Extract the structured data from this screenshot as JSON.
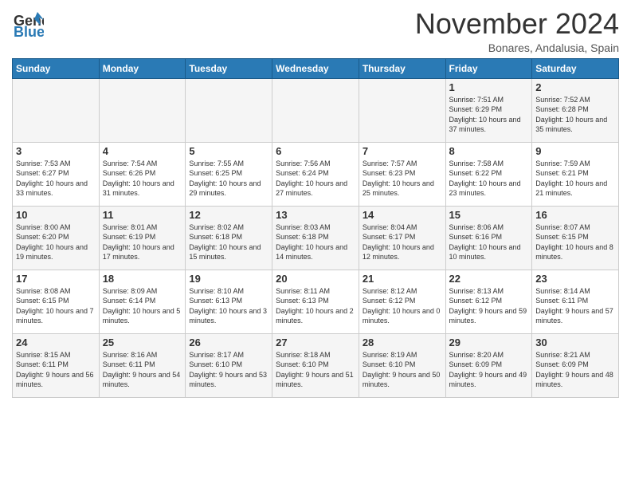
{
  "header": {
    "logo_line1": "General",
    "logo_line2": "Blue",
    "month": "November 2024",
    "location": "Bonares, Andalusia, Spain"
  },
  "weekdays": [
    "Sunday",
    "Monday",
    "Tuesday",
    "Wednesday",
    "Thursday",
    "Friday",
    "Saturday"
  ],
  "weeks": [
    [
      {
        "day": "",
        "sunrise": "",
        "sunset": "",
        "daylight": ""
      },
      {
        "day": "",
        "sunrise": "",
        "sunset": "",
        "daylight": ""
      },
      {
        "day": "",
        "sunrise": "",
        "sunset": "",
        "daylight": ""
      },
      {
        "day": "",
        "sunrise": "",
        "sunset": "",
        "daylight": ""
      },
      {
        "day": "",
        "sunrise": "",
        "sunset": "",
        "daylight": ""
      },
      {
        "day": "1",
        "sunrise": "Sunrise: 7:51 AM",
        "sunset": "Sunset: 6:29 PM",
        "daylight": "Daylight: 10 hours and 37 minutes."
      },
      {
        "day": "2",
        "sunrise": "Sunrise: 7:52 AM",
        "sunset": "Sunset: 6:28 PM",
        "daylight": "Daylight: 10 hours and 35 minutes."
      }
    ],
    [
      {
        "day": "3",
        "sunrise": "Sunrise: 7:53 AM",
        "sunset": "Sunset: 6:27 PM",
        "daylight": "Daylight: 10 hours and 33 minutes."
      },
      {
        "day": "4",
        "sunrise": "Sunrise: 7:54 AM",
        "sunset": "Sunset: 6:26 PM",
        "daylight": "Daylight: 10 hours and 31 minutes."
      },
      {
        "day": "5",
        "sunrise": "Sunrise: 7:55 AM",
        "sunset": "Sunset: 6:25 PM",
        "daylight": "Daylight: 10 hours and 29 minutes."
      },
      {
        "day": "6",
        "sunrise": "Sunrise: 7:56 AM",
        "sunset": "Sunset: 6:24 PM",
        "daylight": "Daylight: 10 hours and 27 minutes."
      },
      {
        "day": "7",
        "sunrise": "Sunrise: 7:57 AM",
        "sunset": "Sunset: 6:23 PM",
        "daylight": "Daylight: 10 hours and 25 minutes."
      },
      {
        "day": "8",
        "sunrise": "Sunrise: 7:58 AM",
        "sunset": "Sunset: 6:22 PM",
        "daylight": "Daylight: 10 hours and 23 minutes."
      },
      {
        "day": "9",
        "sunrise": "Sunrise: 7:59 AM",
        "sunset": "Sunset: 6:21 PM",
        "daylight": "Daylight: 10 hours and 21 minutes."
      }
    ],
    [
      {
        "day": "10",
        "sunrise": "Sunrise: 8:00 AM",
        "sunset": "Sunset: 6:20 PM",
        "daylight": "Daylight: 10 hours and 19 minutes."
      },
      {
        "day": "11",
        "sunrise": "Sunrise: 8:01 AM",
        "sunset": "Sunset: 6:19 PM",
        "daylight": "Daylight: 10 hours and 17 minutes."
      },
      {
        "day": "12",
        "sunrise": "Sunrise: 8:02 AM",
        "sunset": "Sunset: 6:18 PM",
        "daylight": "Daylight: 10 hours and 15 minutes."
      },
      {
        "day": "13",
        "sunrise": "Sunrise: 8:03 AM",
        "sunset": "Sunset: 6:18 PM",
        "daylight": "Daylight: 10 hours and 14 minutes."
      },
      {
        "day": "14",
        "sunrise": "Sunrise: 8:04 AM",
        "sunset": "Sunset: 6:17 PM",
        "daylight": "Daylight: 10 hours and 12 minutes."
      },
      {
        "day": "15",
        "sunrise": "Sunrise: 8:06 AM",
        "sunset": "Sunset: 6:16 PM",
        "daylight": "Daylight: 10 hours and 10 minutes."
      },
      {
        "day": "16",
        "sunrise": "Sunrise: 8:07 AM",
        "sunset": "Sunset: 6:15 PM",
        "daylight": "Daylight: 10 hours and 8 minutes."
      }
    ],
    [
      {
        "day": "17",
        "sunrise": "Sunrise: 8:08 AM",
        "sunset": "Sunset: 6:15 PM",
        "daylight": "Daylight: 10 hours and 7 minutes."
      },
      {
        "day": "18",
        "sunrise": "Sunrise: 8:09 AM",
        "sunset": "Sunset: 6:14 PM",
        "daylight": "Daylight: 10 hours and 5 minutes."
      },
      {
        "day": "19",
        "sunrise": "Sunrise: 8:10 AM",
        "sunset": "Sunset: 6:13 PM",
        "daylight": "Daylight: 10 hours and 3 minutes."
      },
      {
        "day": "20",
        "sunrise": "Sunrise: 8:11 AM",
        "sunset": "Sunset: 6:13 PM",
        "daylight": "Daylight: 10 hours and 2 minutes."
      },
      {
        "day": "21",
        "sunrise": "Sunrise: 8:12 AM",
        "sunset": "Sunset: 6:12 PM",
        "daylight": "Daylight: 10 hours and 0 minutes."
      },
      {
        "day": "22",
        "sunrise": "Sunrise: 8:13 AM",
        "sunset": "Sunset: 6:12 PM",
        "daylight": "Daylight: 9 hours and 59 minutes."
      },
      {
        "day": "23",
        "sunrise": "Sunrise: 8:14 AM",
        "sunset": "Sunset: 6:11 PM",
        "daylight": "Daylight: 9 hours and 57 minutes."
      }
    ],
    [
      {
        "day": "24",
        "sunrise": "Sunrise: 8:15 AM",
        "sunset": "Sunset: 6:11 PM",
        "daylight": "Daylight: 9 hours and 56 minutes."
      },
      {
        "day": "25",
        "sunrise": "Sunrise: 8:16 AM",
        "sunset": "Sunset: 6:11 PM",
        "daylight": "Daylight: 9 hours and 54 minutes."
      },
      {
        "day": "26",
        "sunrise": "Sunrise: 8:17 AM",
        "sunset": "Sunset: 6:10 PM",
        "daylight": "Daylight: 9 hours and 53 minutes."
      },
      {
        "day": "27",
        "sunrise": "Sunrise: 8:18 AM",
        "sunset": "Sunset: 6:10 PM",
        "daylight": "Daylight: 9 hours and 51 minutes."
      },
      {
        "day": "28",
        "sunrise": "Sunrise: 8:19 AM",
        "sunset": "Sunset: 6:10 PM",
        "daylight": "Daylight: 9 hours and 50 minutes."
      },
      {
        "day": "29",
        "sunrise": "Sunrise: 8:20 AM",
        "sunset": "Sunset: 6:09 PM",
        "daylight": "Daylight: 9 hours and 49 minutes."
      },
      {
        "day": "30",
        "sunrise": "Sunrise: 8:21 AM",
        "sunset": "Sunset: 6:09 PM",
        "daylight": "Daylight: 9 hours and 48 minutes."
      }
    ]
  ]
}
